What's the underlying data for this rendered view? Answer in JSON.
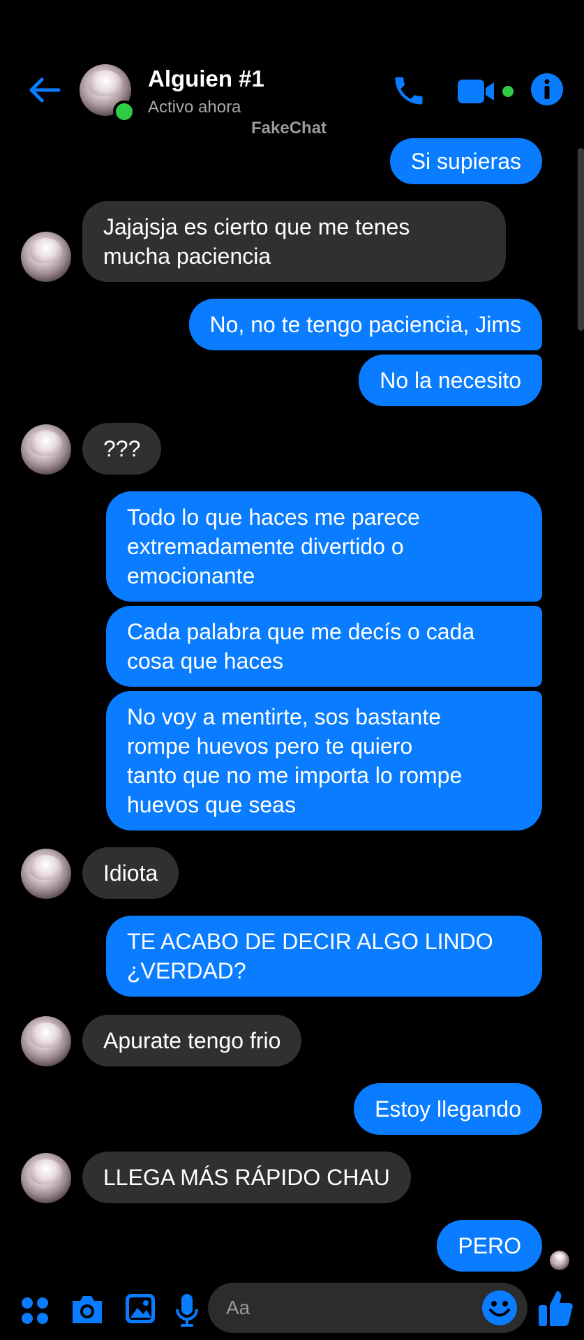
{
  "header": {
    "title": "Alguien #1",
    "subtitle": "Activo ahora",
    "watermark": "FakeChat"
  },
  "messages": [
    {
      "from": "me",
      "text": "Si supieras"
    },
    {
      "from": "them",
      "text": "Jajajsja es cierto que me tenes\nmucha paciencia"
    },
    {
      "from": "me",
      "text": "No, no te tengo paciencia, Jims"
    },
    {
      "from": "me",
      "text": "No la necesito"
    },
    {
      "from": "them",
      "text": "???"
    },
    {
      "from": "me",
      "text": "Todo lo que haces me parece\nextremadamente divertido o\nemocionante"
    },
    {
      "from": "me",
      "text": "Cada palabra que me decís o cada\ncosa que haces"
    },
    {
      "from": "me",
      "text": "No voy a mentirte, sos bastante\nrompe huevos pero te quiero\ntanto que no me importa lo rompe\nhuevos que seas"
    },
    {
      "from": "them",
      "text": "Idiota"
    },
    {
      "from": "me",
      "text": "TE ACABO DE DECIR ALGO LINDO\n¿VERDAD?"
    },
    {
      "from": "them",
      "text": "Apurate tengo frio"
    },
    {
      "from": "me",
      "text": "Estoy llegando"
    },
    {
      "from": "them",
      "text": "LLEGA MÁS RÁPIDO CHAU"
    },
    {
      "from": "me",
      "text": "PERO"
    }
  ],
  "composer": {
    "placeholder": "Aa"
  },
  "colors": {
    "accent": "#0a7cff",
    "online": "#31cc46",
    "incoming_bubble": "#303030",
    "background": "#000000"
  },
  "icons": [
    "back-arrow-icon",
    "phone-icon",
    "video-camera-icon",
    "info-icon",
    "apps-grid-icon",
    "camera-icon",
    "image-icon",
    "microphone-icon",
    "emoji-icon",
    "thumbs-up-icon"
  ]
}
